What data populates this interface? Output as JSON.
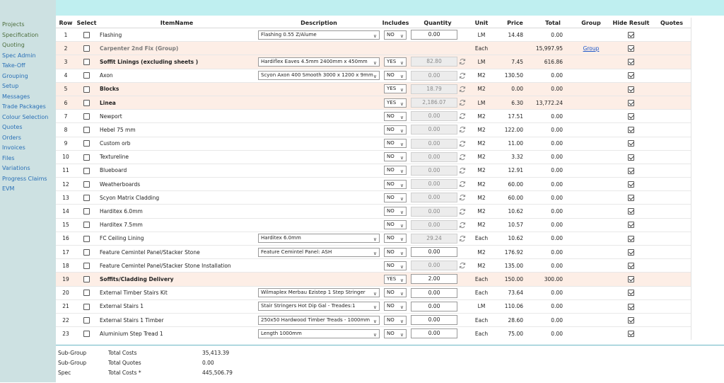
{
  "sidebar": {
    "items": [
      {
        "label": "Projects",
        "muted": true
      },
      {
        "label": "Specification",
        "muted": true
      },
      {
        "label": "Quoting",
        "muted": true
      },
      {
        "label": "Spec Admin",
        "muted": false
      },
      {
        "label": "Take-Off",
        "muted": false
      },
      {
        "label": "Grouping",
        "muted": false
      },
      {
        "label": "Setup",
        "muted": false
      },
      {
        "label": "Messages",
        "muted": false
      },
      {
        "label": "Trade Packages",
        "muted": false
      },
      {
        "label": "Colour Selection",
        "muted": false
      },
      {
        "label": "Quotes",
        "muted": false
      },
      {
        "label": "Orders",
        "muted": false
      },
      {
        "label": "Invoices",
        "muted": false
      },
      {
        "label": "Files",
        "muted": false
      },
      {
        "label": "Variations",
        "muted": false
      },
      {
        "label": "Progress Claims",
        "muted": false
      },
      {
        "label": "EVM",
        "muted": false
      }
    ]
  },
  "table": {
    "headers": {
      "row": "Row",
      "select": "Select",
      "item": "ItemName",
      "description": "Description",
      "includes": "Includes",
      "quantity": "Quantity",
      "unit": "Unit",
      "price": "Price",
      "total": "Total",
      "group": "Group",
      "hide": "Hide Result",
      "quotes": "Quotes"
    },
    "rows": [
      {
        "row": "1",
        "item": "Flashing",
        "desc": "Flashing 0.55 Z/Alume",
        "inc": "NO",
        "qty": "0.00",
        "qtyDisabled": false,
        "refresh": false,
        "unit": "LM",
        "price": "14.48",
        "total": "0.00",
        "group": "",
        "style": "normal"
      },
      {
        "row": "2",
        "item": "Carpenter 2nd Fix (Group)",
        "desc": "",
        "inc": "",
        "qty": "",
        "qtyDisabled": false,
        "refresh": false,
        "unit": "Each",
        "price": "",
        "total": "15,997.95",
        "group": "Group",
        "style": "grp2"
      },
      {
        "row": "3",
        "item": "Soffit Linings (excluding sheets )",
        "desc": "Hardiflex Eaves 4.5mm 2400mm x 450mm",
        "inc": "YES",
        "qty": "82.80",
        "qtyDisabled": true,
        "refresh": true,
        "unit": "LM",
        "price": "7.45",
        "total": "616.86",
        "group": "",
        "style": "grp"
      },
      {
        "row": "4",
        "item": "Axon",
        "desc": "Scyon Axon 400 Smooth 3000 x 1200 x 9mm",
        "inc": "NO",
        "qty": "0.00",
        "qtyDisabled": true,
        "refresh": true,
        "unit": "M2",
        "price": "130.50",
        "total": "0.00",
        "group": "",
        "style": "normal"
      },
      {
        "row": "5",
        "item": "Blocks",
        "desc": "",
        "inc": "YES",
        "qty": "18.79",
        "qtyDisabled": true,
        "refresh": true,
        "unit": "M2",
        "price": "0.00",
        "total": "0.00",
        "group": "",
        "style": "grp"
      },
      {
        "row": "6",
        "item": "Linea",
        "desc": "",
        "inc": "YES",
        "qty": "2,186.07",
        "qtyDisabled": true,
        "refresh": true,
        "unit": "LM",
        "price": "6.30",
        "total": "13,772.24",
        "group": "",
        "style": "grp"
      },
      {
        "row": "7",
        "item": "Newport",
        "desc": "",
        "inc": "NO",
        "qty": "0.00",
        "qtyDisabled": true,
        "refresh": true,
        "unit": "M2",
        "price": "17.51",
        "total": "0.00",
        "group": "",
        "style": "normal"
      },
      {
        "row": "8",
        "item": "Hebel 75 mm",
        "desc": "",
        "inc": "NO",
        "qty": "0.00",
        "qtyDisabled": true,
        "refresh": true,
        "unit": "M2",
        "price": "122.00",
        "total": "0.00",
        "group": "",
        "style": "normal"
      },
      {
        "row": "9",
        "item": "Custom orb",
        "desc": "",
        "inc": "NO",
        "qty": "0.00",
        "qtyDisabled": true,
        "refresh": true,
        "unit": "M2",
        "price": "11.00",
        "total": "0.00",
        "group": "",
        "style": "normal"
      },
      {
        "row": "10",
        "item": "Textureline",
        "desc": "",
        "inc": "NO",
        "qty": "0.00",
        "qtyDisabled": true,
        "refresh": true,
        "unit": "M2",
        "price": "3.32",
        "total": "0.00",
        "group": "",
        "style": "normal"
      },
      {
        "row": "11",
        "item": "Blueboard",
        "desc": "",
        "inc": "NO",
        "qty": "0.00",
        "qtyDisabled": true,
        "refresh": true,
        "unit": "M2",
        "price": "12.91",
        "total": "0.00",
        "group": "",
        "style": "normal"
      },
      {
        "row": "12",
        "item": "Weatherboards",
        "desc": "",
        "inc": "NO",
        "qty": "0.00",
        "qtyDisabled": true,
        "refresh": true,
        "unit": "M2",
        "price": "60.00",
        "total": "0.00",
        "group": "",
        "style": "normal"
      },
      {
        "row": "13",
        "item": "Scyon Matrix Cladding",
        "desc": "",
        "inc": "NO",
        "qty": "0.00",
        "qtyDisabled": true,
        "refresh": true,
        "unit": "M2",
        "price": "60.00",
        "total": "0.00",
        "group": "",
        "style": "normal"
      },
      {
        "row": "14",
        "item": "Harditex 6.0mm",
        "desc": "",
        "inc": "NO",
        "qty": "0.00",
        "qtyDisabled": true,
        "refresh": true,
        "unit": "M2",
        "price": "10.62",
        "total": "0.00",
        "group": "",
        "style": "normal"
      },
      {
        "row": "15",
        "item": "Harditex 7.5mm",
        "desc": "",
        "inc": "NO",
        "qty": "0.00",
        "qtyDisabled": true,
        "refresh": true,
        "unit": "M2",
        "price": "10.57",
        "total": "0.00",
        "group": "",
        "style": "normal"
      },
      {
        "row": "16",
        "item": "FC Ceiling Lining",
        "desc": "Harditex 6.0mm",
        "inc": "NO",
        "qty": "29.24",
        "qtyDisabled": true,
        "refresh": true,
        "unit": "Each",
        "price": "10.62",
        "total": "0.00",
        "group": "",
        "style": "normal"
      },
      {
        "row": "17",
        "item": "Feature Cemintel Panel/Stacker Stone",
        "desc": "Feature Cemintel Panel: ASH",
        "inc": "NO",
        "qty": "0.00",
        "qtyDisabled": false,
        "refresh": false,
        "unit": "M2",
        "price": "176.92",
        "total": "0.00",
        "group": "",
        "style": "normal"
      },
      {
        "row": "18",
        "item": "Feature Cemintel Panel/Stacker Stone Installation",
        "desc": "",
        "inc": "NO",
        "qty": "0.00",
        "qtyDisabled": true,
        "refresh": true,
        "unit": "M2",
        "price": "135.00",
        "total": "0.00",
        "group": "",
        "style": "normal"
      },
      {
        "row": "19",
        "item": "Soffits/Cladding Delivery",
        "desc": "",
        "inc": "YES",
        "qty": "2.00",
        "qtyDisabled": false,
        "refresh": false,
        "unit": "Each",
        "price": "150.00",
        "total": "300.00",
        "group": "",
        "style": "grp"
      },
      {
        "row": "20",
        "item": "External Timber Stairs Kit",
        "desc": "Wilmaplex Merbau Ezistep 1 Step Stringer",
        "inc": "NO",
        "qty": "0.00",
        "qtyDisabled": false,
        "refresh": false,
        "unit": "Each",
        "price": "73.64",
        "total": "0.00",
        "group": "",
        "style": "normal"
      },
      {
        "row": "21",
        "item": "External Stairs 1",
        "desc": "Stair Stringers Hot Dip Gal - Treades:1",
        "inc": "NO",
        "qty": "0.00",
        "qtyDisabled": false,
        "refresh": false,
        "unit": "LM",
        "price": "110.06",
        "total": "0.00",
        "group": "",
        "style": "normal"
      },
      {
        "row": "22",
        "item": "External Stairs 1 Timber",
        "desc": "250x50 Hardwood Timber Treads - 1000mm",
        "inc": "NO",
        "qty": "0.00",
        "qtyDisabled": false,
        "refresh": false,
        "unit": "Each",
        "price": "28.60",
        "total": "0.00",
        "group": "",
        "style": "normal"
      },
      {
        "row": "23",
        "item": "Aluminium Step Tread 1",
        "desc": "Length 1000mm",
        "inc": "NO",
        "qty": "0.00",
        "qtyDisabled": false,
        "refresh": false,
        "unit": "Each",
        "price": "75.00",
        "total": "0.00",
        "group": "",
        "style": "normal"
      }
    ]
  },
  "footer": {
    "rows": [
      {
        "a": "Sub-Group",
        "b": "Total Costs",
        "c": "35,413.39"
      },
      {
        "a": "Sub-Group",
        "b": "Total Quotes",
        "c": "0.00"
      },
      {
        "a": "Spec",
        "b": "Total Costs *",
        "c": "445,506.79"
      }
    ]
  },
  "colors": {
    "sidebar": "#cde1e2",
    "topbar": "#bfeff0",
    "groupRow": "#fdeee6",
    "link": "#2a70b6"
  }
}
